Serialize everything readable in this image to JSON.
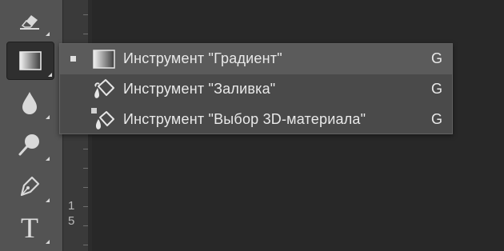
{
  "toolbar": {
    "tools": [
      {
        "name": "eraser-tool",
        "icon": "eraser-icon"
      },
      {
        "name": "gradient-tool",
        "icon": "gradient-icon",
        "active": true
      },
      {
        "name": "blur-tool",
        "icon": "drop-icon"
      },
      {
        "name": "dodge-tool",
        "icon": "dodge-icon"
      },
      {
        "name": "pen-tool",
        "icon": "pen-icon"
      },
      {
        "name": "type-tool",
        "icon": "type-icon",
        "glyph": "T"
      }
    ]
  },
  "ruler": {
    "digits": [
      "1",
      "5"
    ]
  },
  "flyout": {
    "items": [
      {
        "label": "Инструмент \"Градиент\"",
        "shortcut": "G",
        "icon": "gradient-icon",
        "selected": true
      },
      {
        "label": "Инструмент \"Заливка\"",
        "shortcut": "G",
        "icon": "paint-bucket-icon"
      },
      {
        "label": "Инструмент \"Выбор 3D-материала\"",
        "shortcut": "G",
        "icon": "3d-material-drop-icon"
      }
    ]
  },
  "colors": {
    "canvas": "#282828",
    "toolbar": "#535353",
    "menu": "#4a4a4a",
    "menu_selected": "#5b5b5b",
    "text": "#e9e9e9"
  }
}
